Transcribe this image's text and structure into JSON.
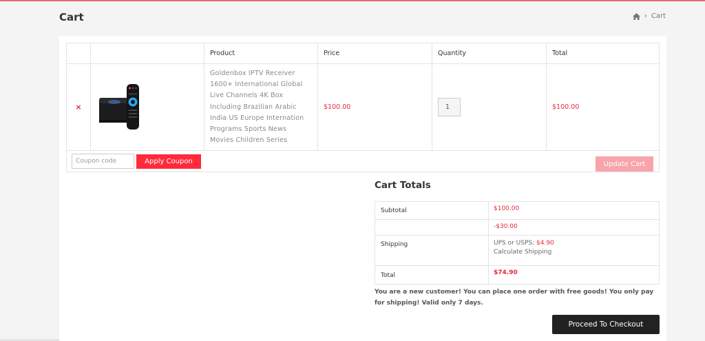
{
  "header": {
    "page_title": "Cart",
    "breadcrumb_current": "Cart",
    "breadcrumb_separator": "›"
  },
  "cart_table": {
    "columns": [
      "",
      "",
      "Product",
      "Price",
      "Quantity",
      "Total"
    ],
    "rows": [
      {
        "remove_label": "×",
        "product_name": "Goldenbox IPTV Receiver 1600+ International Global Live Channels 4K Box Including Brazilian Arabic India US Europe Internation Programs Sports News Movies Children Series",
        "price": "$100.00",
        "quantity": "1",
        "total": "$100.00"
      }
    ]
  },
  "actions": {
    "coupon_placeholder": "Coupon code",
    "apply_coupon_label": "Apply Coupon",
    "update_cart_label": "Update Cart"
  },
  "cart_totals": {
    "title": "Cart Totals",
    "subtotal_label": "Subtotal",
    "subtotal_value": "$100.00",
    "discount_value": "-$30.00",
    "shipping_label": "Shipping",
    "shipping_method": "UPS or USPS:",
    "shipping_cost": "$4.90",
    "calculate_shipping": "Calculate Shipping",
    "total_label": "Total",
    "total_value": "$74.90"
  },
  "notice": "You are a new customer! You can place one order with free goods! You only pay for shipping! Valid only 7 days.",
  "checkout_label": "Proceed To Checkout",
  "colors": {
    "accent_red": "#ff2a3c",
    "price_red": "#e8283a",
    "update_disabled": "#f9a3ab",
    "checkout_dark": "#222222"
  },
  "icons": [
    "home-icon",
    "remove-icon",
    "tv-box-image",
    "remote-control-image"
  ]
}
